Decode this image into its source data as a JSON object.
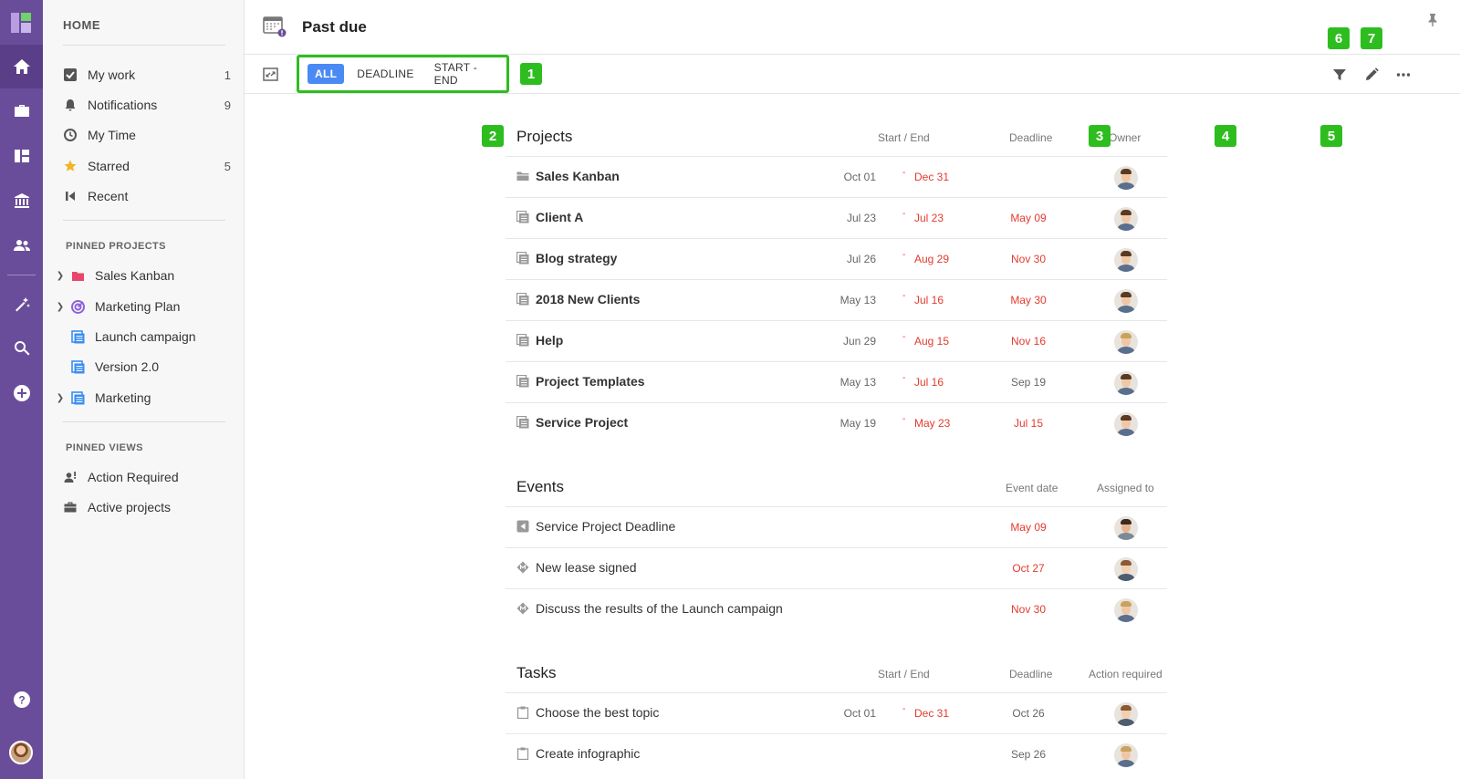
{
  "header": {
    "title": "Past due"
  },
  "toolbar": {
    "filters": [
      {
        "label": "ALL",
        "active": true
      },
      {
        "label": "DEADLINE",
        "active": false
      },
      {
        "label": "START - END",
        "active": false
      }
    ]
  },
  "badges": [
    "1",
    "2",
    "3",
    "4",
    "5",
    "6",
    "7"
  ],
  "sidebar": {
    "home_label": "HOME",
    "items": [
      {
        "label": "My work",
        "count": "1",
        "icon": "check-icon"
      },
      {
        "label": "Notifications",
        "count": "9",
        "icon": "bell-icon"
      },
      {
        "label": "My Time",
        "count": "",
        "icon": "clock-icon"
      },
      {
        "label": "Starred",
        "count": "5",
        "icon": "star-icon"
      },
      {
        "label": "Recent",
        "count": "",
        "icon": "recent-icon"
      }
    ],
    "pinned_projects_label": "PINNED PROJECTS",
    "pinned_projects": [
      {
        "label": "Sales Kanban",
        "icon": "folder-icon",
        "expandable": true
      },
      {
        "label": "Marketing Plan",
        "icon": "target-icon",
        "expandable": true
      },
      {
        "label": "Launch campaign",
        "icon": "list-icon",
        "expandable": false
      },
      {
        "label": "Version 2.0",
        "icon": "list-icon",
        "expandable": false
      },
      {
        "label": "Marketing",
        "icon": "list-icon",
        "expandable": true
      }
    ],
    "pinned_views_label": "PINNED VIEWS",
    "pinned_views": [
      {
        "label": "Action Required",
        "icon": "user-alert-icon"
      },
      {
        "label": "Active projects",
        "icon": "briefcase-icon"
      }
    ]
  },
  "projects": {
    "title": "Projects",
    "col_start_end": "Start / End",
    "col_deadline": "Deadline",
    "col_owner": "Owner",
    "rows": [
      {
        "name": "Sales Kanban",
        "icon": "folder-icon",
        "start": "Oct 01",
        "end": "Dec 31",
        "deadline": "",
        "deadline_overdue": false
      },
      {
        "name": "Client A",
        "icon": "project-icon",
        "start": "Jul 23",
        "end": "Jul 23",
        "deadline": "May 09",
        "deadline_overdue": true
      },
      {
        "name": "Blog strategy",
        "icon": "project-icon",
        "start": "Jul 26",
        "end": "Aug 29",
        "deadline": "Nov 30",
        "deadline_overdue": true
      },
      {
        "name": "2018 New Clients",
        "icon": "project-icon",
        "start": "May 13",
        "end": "Jul 16",
        "deadline": "May 30",
        "deadline_overdue": true
      },
      {
        "name": "Help",
        "icon": "project-icon",
        "start": "Jun 29",
        "end": "Aug 15",
        "deadline": "Nov 16",
        "deadline_overdue": true
      },
      {
        "name": "Project Templates",
        "icon": "project-icon",
        "start": "May 13",
        "end": "Jul 16",
        "deadline": "Sep 19",
        "deadline_overdue": false
      },
      {
        "name": "Service Project",
        "icon": "project-icon",
        "start": "May 19",
        "end": "May 23",
        "deadline": "Jul 15",
        "deadline_overdue": true
      }
    ]
  },
  "events": {
    "title": "Events",
    "col_event_date": "Event date",
    "col_assigned": "Assigned to",
    "rows": [
      {
        "name": "Service Project Deadline",
        "icon": "flag-icon",
        "date": "May 09"
      },
      {
        "name": "New lease signed",
        "icon": "milestone-icon",
        "date": "Oct 27"
      },
      {
        "name": "Discuss the results of the Launch campaign",
        "icon": "milestone-icon",
        "date": "Nov 30"
      }
    ]
  },
  "tasks": {
    "title": "Tasks",
    "col_start_end": "Start / End",
    "col_deadline": "Deadline",
    "col_action": "Action required",
    "rows": [
      {
        "name": "Choose the best topic",
        "icon": "task-icon",
        "start": "Oct 01",
        "end": "Dec 31",
        "deadline": "Oct 26"
      },
      {
        "name": "Create infographic",
        "icon": "task-icon",
        "start": "",
        "end": "",
        "deadline": "Sep 26"
      }
    ]
  },
  "colors": {
    "rail": "#6a4d9a",
    "accent": "#4a8af4",
    "overdue": "#e23b2e",
    "badge": "#2ebd1f"
  }
}
